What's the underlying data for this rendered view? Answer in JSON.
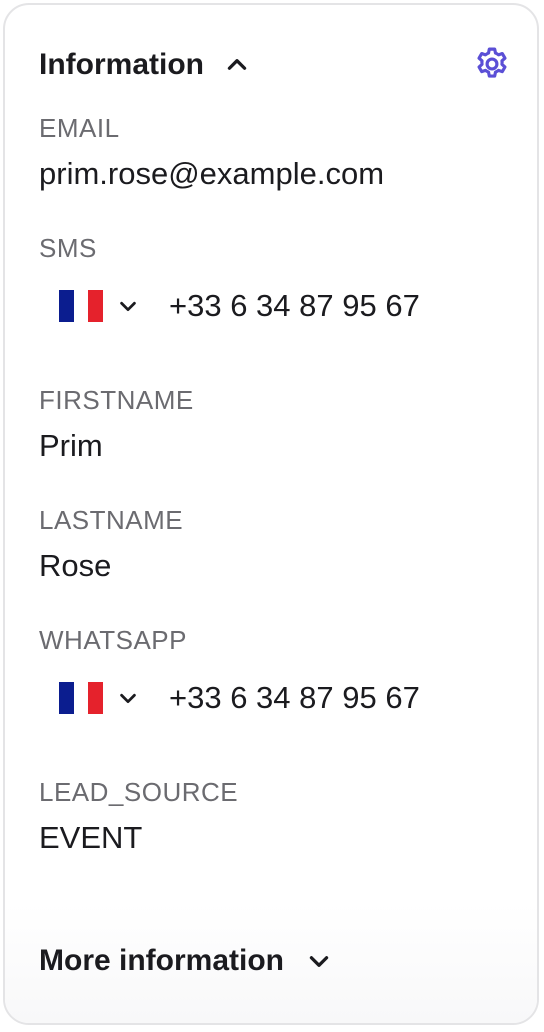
{
  "header": {
    "title": "Information",
    "toggle_icon": "chevron-up-icon",
    "settings_icon": "gear-icon"
  },
  "fields": {
    "email": {
      "label": "EMAIL",
      "value": "prim.rose@example.com"
    },
    "sms": {
      "label": "SMS",
      "country_flag": "france-flag",
      "value": "+33 6 34 87 95 67"
    },
    "firstname": {
      "label": "FIRSTNAME",
      "value": "Prim"
    },
    "lastname": {
      "label": "LASTNAME",
      "value": "Rose"
    },
    "whatsapp": {
      "label": "WHATSAPP",
      "country_flag": "france-flag",
      "value": "+33 6 34 87 95 67"
    },
    "lead_source": {
      "label": "LEAD_SOURCE",
      "value": "EVENT"
    }
  },
  "footer": {
    "more_label": "More information",
    "toggle_icon": "chevron-down-icon"
  },
  "colors": {
    "accent": "#5b4fd6",
    "text": "#1b1b1f",
    "label": "#6b6b70",
    "border": "#e4e4e6"
  }
}
